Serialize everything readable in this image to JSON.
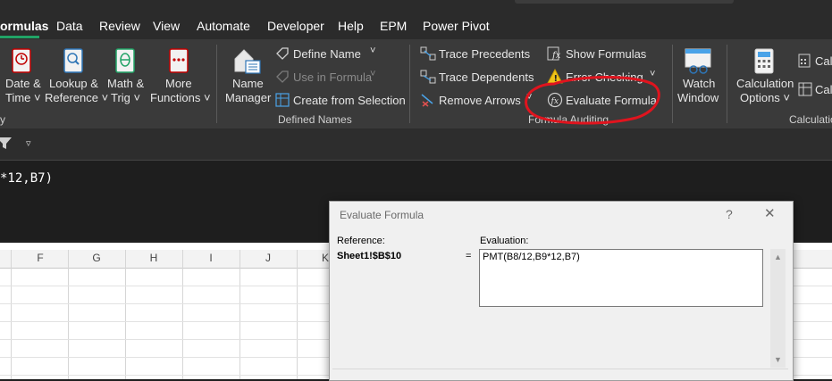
{
  "tabs": [
    {
      "label": "ormulas",
      "active": true
    },
    {
      "label": "Data"
    },
    {
      "label": "Review"
    },
    {
      "label": "View"
    },
    {
      "label": "Automate"
    },
    {
      "label": "Developer"
    },
    {
      "label": "Help"
    },
    {
      "label": "EPM"
    },
    {
      "label": "Power Pivot"
    }
  ],
  "ribbon": {
    "function_library": {
      "date_time": {
        "line1": "Date &",
        "line2": "Time ˅"
      },
      "lookup_reference": {
        "line1": "Lookup &",
        "line2": "Reference ˅"
      },
      "math_trig": {
        "line1": "Math &",
        "line2": "Trig ˅"
      },
      "more_functions": {
        "line1": "More",
        "line2": "Functions ˅"
      }
    },
    "defined_names": {
      "name_manager": {
        "line1": "Name",
        "line2": "Manager"
      },
      "define_name": "Define Name",
      "use_in_formula": "Use in Formula",
      "create_from_selection": "Create from Selection",
      "group_label": "Defined Names"
    },
    "formula_auditing": {
      "trace_precedents": "Trace Precedents",
      "trace_dependents": "Trace Dependents",
      "remove_arrows": "Remove Arrows",
      "show_formulas": "Show Formulas",
      "error_checking": "Error Checking",
      "evaluate_formula": "Evaluate Formula",
      "group_label": "Formula Auditing"
    },
    "watch_window": {
      "line1": "Watch",
      "line2": "Window"
    },
    "calculation": {
      "options": {
        "line1": "Calculation",
        "line2": "Options ˅"
      },
      "calc_now": "Cal",
      "calc_sheet": "Cal",
      "group_label": "Calculation"
    },
    "partial_group_label": "y",
    "accent_red": "#e0141e"
  },
  "formula_bar": {
    "text": "*12,B7)"
  },
  "columns": [
    "F",
    "G",
    "H",
    "I",
    "J",
    "K"
  ],
  "dialog": {
    "title": "Evaluate Formula",
    "help": "?",
    "close": "✕",
    "reference_label": "Reference:",
    "reference_value": "Sheet1!$B$10",
    "equals": "=",
    "evaluation_label": "Evaluation:",
    "evaluation_text": "PMT(B8/12,B9*12,B7)"
  }
}
